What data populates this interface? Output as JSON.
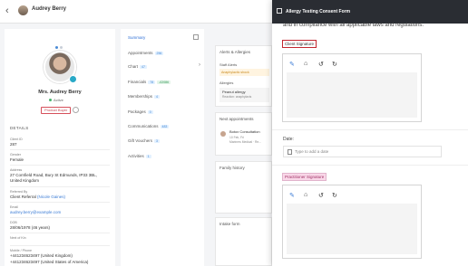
{
  "header": {
    "back_icon": "‹",
    "patient_name": "Audrey Berry"
  },
  "profile": {
    "name": "Mrs. Audrey Berry",
    "status": "Active",
    "badge": "Product Buyer",
    "details_title": "DETAILS",
    "fields": [
      {
        "label": "Client ID",
        "value": "287"
      },
      {
        "label": "Gender",
        "value": "Female"
      },
      {
        "label": "Address",
        "value": "27 Cornfield Road, Bury St Edmunds, IP33 3BL, United Kingdom"
      },
      {
        "label": "Referred By",
        "value": "Client Referral",
        "extra": "(Nicole Gaines)"
      },
      {
        "label": "Email",
        "value": "audrey.berry@example.com"
      },
      {
        "label": "DOB",
        "value": "28/06/1978 (46 years)"
      },
      {
        "label": "Next of Kin",
        "value": ""
      },
      {
        "label": "Mobile / Phone",
        "value": "+441234623497 (United Kingdom)",
        "value2": "+441234623497 (United States of America)"
      }
    ]
  },
  "tabs": [
    {
      "label": "Summary",
      "count": ""
    },
    {
      "label": "Appointments",
      "count": "256"
    },
    {
      "label": "Chart",
      "count": "47"
    },
    {
      "label": "Financials",
      "count": "78",
      "extra": "-£2086"
    },
    {
      "label": "Memberships",
      "count": "4"
    },
    {
      "label": "Packages",
      "count": "0"
    },
    {
      "label": "Communications",
      "count": "483"
    },
    {
      "label": "Gift Vouchers",
      "count": "3"
    },
    {
      "label": "Activities",
      "count": "1"
    }
  ],
  "summary": {
    "alerts_title": "Alerts & Allergies",
    "staff_alerts_label": "Staff Alerts",
    "staff_alert": "Anaphylactic shock",
    "allergies_label": "Allergies",
    "allergy_name": "Peanut allergy",
    "allergy_detail": "Reaction: anaphylaxis",
    "next_appt_title": "Next appointments",
    "appt_name": "Botox Consultation",
    "appt_date": "10 Feb, Fri",
    "appt_location": "Mariners Medical · Re...",
    "family_history": "Family history",
    "intake_form": "Intake form"
  },
  "modal": {
    "title": "Allergy Testing Consent Form",
    "compliance_text": "and in compliance with all applicable laws and regulations.",
    "client_signature_label": "Client Signature",
    "date_label": "Date:",
    "date_placeholder": "Type to add a date",
    "practitioner_signature_label": "Practitioner Signature",
    "tools": [
      "✎",
      "⌂",
      "↺",
      "↻"
    ]
  }
}
